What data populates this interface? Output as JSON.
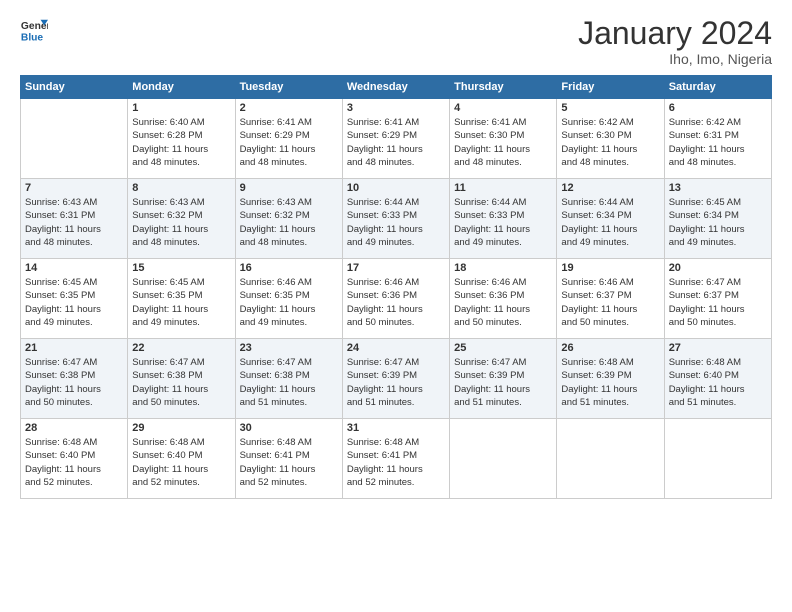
{
  "header": {
    "logo": {
      "line1": "General",
      "line2": "Blue"
    },
    "title": "January 2024",
    "subtitle": "Iho, Imo, Nigeria"
  },
  "weekdays": [
    "Sunday",
    "Monday",
    "Tuesday",
    "Wednesday",
    "Thursday",
    "Friday",
    "Saturday"
  ],
  "weeks": [
    [
      {
        "day": "",
        "info": ""
      },
      {
        "day": "1",
        "info": "Sunrise: 6:40 AM\nSunset: 6:28 PM\nDaylight: 11 hours\nand 48 minutes."
      },
      {
        "day": "2",
        "info": "Sunrise: 6:41 AM\nSunset: 6:29 PM\nDaylight: 11 hours\nand 48 minutes."
      },
      {
        "day": "3",
        "info": "Sunrise: 6:41 AM\nSunset: 6:29 PM\nDaylight: 11 hours\nand 48 minutes."
      },
      {
        "day": "4",
        "info": "Sunrise: 6:41 AM\nSunset: 6:30 PM\nDaylight: 11 hours\nand 48 minutes."
      },
      {
        "day": "5",
        "info": "Sunrise: 6:42 AM\nSunset: 6:30 PM\nDaylight: 11 hours\nand 48 minutes."
      },
      {
        "day": "6",
        "info": "Sunrise: 6:42 AM\nSunset: 6:31 PM\nDaylight: 11 hours\nand 48 minutes."
      }
    ],
    [
      {
        "day": "7",
        "info": "Sunrise: 6:43 AM\nSunset: 6:31 PM\nDaylight: 11 hours\nand 48 minutes."
      },
      {
        "day": "8",
        "info": "Sunrise: 6:43 AM\nSunset: 6:32 PM\nDaylight: 11 hours\nand 48 minutes."
      },
      {
        "day": "9",
        "info": "Sunrise: 6:43 AM\nSunset: 6:32 PM\nDaylight: 11 hours\nand 48 minutes."
      },
      {
        "day": "10",
        "info": "Sunrise: 6:44 AM\nSunset: 6:33 PM\nDaylight: 11 hours\nand 49 minutes."
      },
      {
        "day": "11",
        "info": "Sunrise: 6:44 AM\nSunset: 6:33 PM\nDaylight: 11 hours\nand 49 minutes."
      },
      {
        "day": "12",
        "info": "Sunrise: 6:44 AM\nSunset: 6:34 PM\nDaylight: 11 hours\nand 49 minutes."
      },
      {
        "day": "13",
        "info": "Sunrise: 6:45 AM\nSunset: 6:34 PM\nDaylight: 11 hours\nand 49 minutes."
      }
    ],
    [
      {
        "day": "14",
        "info": "Sunrise: 6:45 AM\nSunset: 6:35 PM\nDaylight: 11 hours\nand 49 minutes."
      },
      {
        "day": "15",
        "info": "Sunrise: 6:45 AM\nSunset: 6:35 PM\nDaylight: 11 hours\nand 49 minutes."
      },
      {
        "day": "16",
        "info": "Sunrise: 6:46 AM\nSunset: 6:35 PM\nDaylight: 11 hours\nand 49 minutes."
      },
      {
        "day": "17",
        "info": "Sunrise: 6:46 AM\nSunset: 6:36 PM\nDaylight: 11 hours\nand 50 minutes."
      },
      {
        "day": "18",
        "info": "Sunrise: 6:46 AM\nSunset: 6:36 PM\nDaylight: 11 hours\nand 50 minutes."
      },
      {
        "day": "19",
        "info": "Sunrise: 6:46 AM\nSunset: 6:37 PM\nDaylight: 11 hours\nand 50 minutes."
      },
      {
        "day": "20",
        "info": "Sunrise: 6:47 AM\nSunset: 6:37 PM\nDaylight: 11 hours\nand 50 minutes."
      }
    ],
    [
      {
        "day": "21",
        "info": "Sunrise: 6:47 AM\nSunset: 6:38 PM\nDaylight: 11 hours\nand 50 minutes."
      },
      {
        "day": "22",
        "info": "Sunrise: 6:47 AM\nSunset: 6:38 PM\nDaylight: 11 hours\nand 50 minutes."
      },
      {
        "day": "23",
        "info": "Sunrise: 6:47 AM\nSunset: 6:38 PM\nDaylight: 11 hours\nand 51 minutes."
      },
      {
        "day": "24",
        "info": "Sunrise: 6:47 AM\nSunset: 6:39 PM\nDaylight: 11 hours\nand 51 minutes."
      },
      {
        "day": "25",
        "info": "Sunrise: 6:47 AM\nSunset: 6:39 PM\nDaylight: 11 hours\nand 51 minutes."
      },
      {
        "day": "26",
        "info": "Sunrise: 6:48 AM\nSunset: 6:39 PM\nDaylight: 11 hours\nand 51 minutes."
      },
      {
        "day": "27",
        "info": "Sunrise: 6:48 AM\nSunset: 6:40 PM\nDaylight: 11 hours\nand 51 minutes."
      }
    ],
    [
      {
        "day": "28",
        "info": "Sunrise: 6:48 AM\nSunset: 6:40 PM\nDaylight: 11 hours\nand 52 minutes."
      },
      {
        "day": "29",
        "info": "Sunrise: 6:48 AM\nSunset: 6:40 PM\nDaylight: 11 hours\nand 52 minutes."
      },
      {
        "day": "30",
        "info": "Sunrise: 6:48 AM\nSunset: 6:41 PM\nDaylight: 11 hours\nand 52 minutes."
      },
      {
        "day": "31",
        "info": "Sunrise: 6:48 AM\nSunset: 6:41 PM\nDaylight: 11 hours\nand 52 minutes."
      },
      {
        "day": "",
        "info": ""
      },
      {
        "day": "",
        "info": ""
      },
      {
        "day": "",
        "info": ""
      }
    ]
  ]
}
